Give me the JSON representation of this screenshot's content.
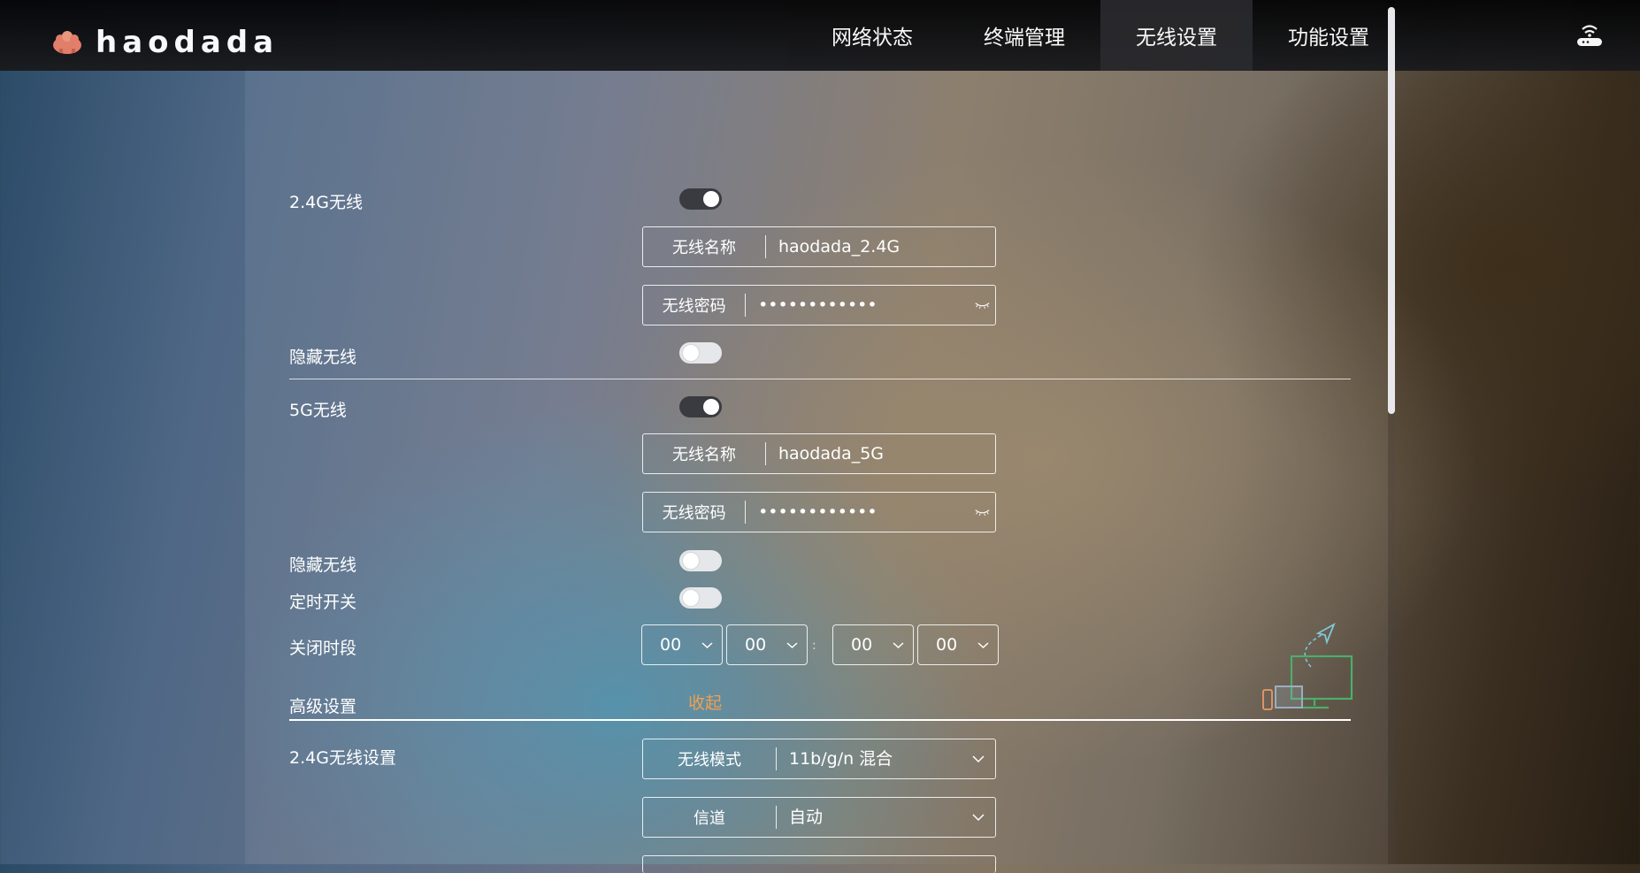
{
  "brand": {
    "name": "haodada"
  },
  "nav": {
    "items": [
      {
        "label": "网络状态"
      },
      {
        "label": "终端管理"
      },
      {
        "label": "无线设置"
      },
      {
        "label": "功能设置"
      }
    ],
    "active_index": 2
  },
  "wifi24": {
    "label": "2.4G无线",
    "enabled": true,
    "ssid_label": "无线名称",
    "ssid": "haodada_2.4G",
    "password_label": "无线密码",
    "password": "••••••••••••",
    "hide_label": "隐藏无线",
    "hidden": false
  },
  "wifi5": {
    "label": "5G无线",
    "enabled": true,
    "ssid_label": "无线名称",
    "ssid": "haodada_5G",
    "password_label": "无线密码",
    "password": "••••••••••••",
    "hide_label": "隐藏无线",
    "hidden": false
  },
  "schedule": {
    "label": "定时开关",
    "enabled": false,
    "off_period_label": "关闭时段",
    "start_hour": "00",
    "start_minute": "00",
    "end_hour": "00",
    "end_minute": "00",
    "separator": ":"
  },
  "advanced": {
    "label": "高级设置",
    "collapse_label": "收起",
    "link_color": "#f0a050",
    "wifi24_settings_label": "2.4G无线设置",
    "mode_label": "无线模式",
    "mode_value": "11b/g/n 混合",
    "channel_label": "信道",
    "channel_value": "自动"
  }
}
